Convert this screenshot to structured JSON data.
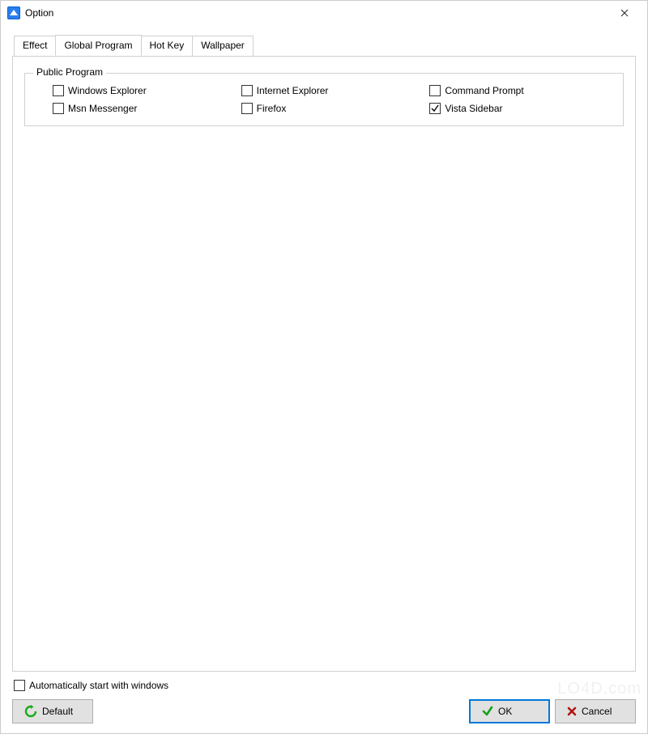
{
  "window": {
    "title": "Option"
  },
  "tabs": [
    {
      "label": "Effect",
      "active": false
    },
    {
      "label": "Global Program",
      "active": true
    },
    {
      "label": "Hot Key",
      "active": false
    },
    {
      "label": "Wallpaper",
      "active": false
    }
  ],
  "group": {
    "title": "Public Program",
    "items": [
      {
        "label": "Windows Explorer",
        "checked": false
      },
      {
        "label": "Internet Explorer",
        "checked": false
      },
      {
        "label": "Command Prompt",
        "checked": false
      },
      {
        "label": "Msn Messenger",
        "checked": false
      },
      {
        "label": "Firefox",
        "checked": false
      },
      {
        "label": "Vista Sidebar",
        "checked": true
      }
    ]
  },
  "autostart": {
    "label": "Automatically start with windows",
    "checked": false
  },
  "buttons": {
    "default": "Default",
    "ok": "OK",
    "cancel": "Cancel"
  },
  "watermark": "LO4D.com"
}
